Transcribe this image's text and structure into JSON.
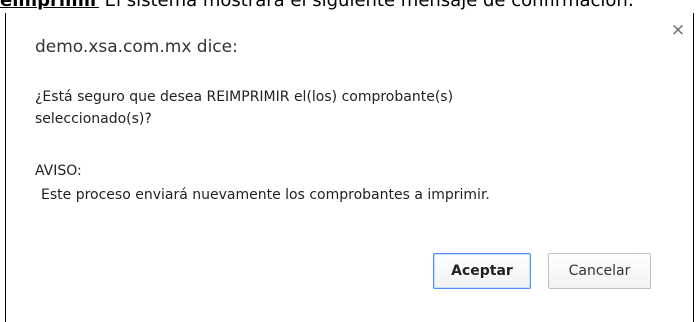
{
  "background_text": {
    "bold": "eimprimir",
    "rest": " El sistema mostrará el siguiente mensaje de confirmación:"
  },
  "dialog": {
    "title": "demo.xsa.com.mx dice:",
    "close_label": "×",
    "question_line1": "¿Está seguro que desea REIMPRIMIR el(los) comprobante(s)",
    "question_line2": "seleccionado(s)?",
    "notice_heading": "AVISO:",
    "notice_text": "Este proceso enviará nuevamente los comprobantes a imprimir.",
    "accept_label": "Aceptar",
    "cancel_label": "Cancelar"
  },
  "colors": {
    "accept_border": "#4d90fe",
    "text": "#222222",
    "dialog_border": "#000000"
  }
}
